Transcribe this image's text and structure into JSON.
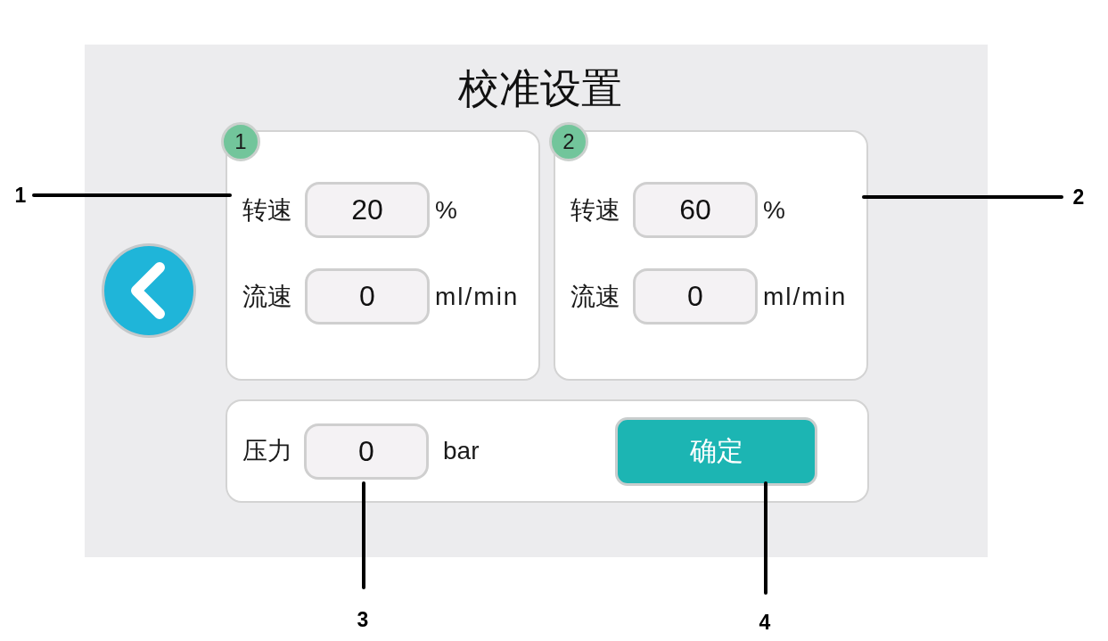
{
  "title": "校准设置",
  "cards": [
    {
      "badge": "1",
      "rows": [
        {
          "label": "转速",
          "value": "20",
          "unit": "%"
        },
        {
          "label": "流速",
          "value": "0",
          "unit": "ml/min"
        }
      ]
    },
    {
      "badge": "2",
      "rows": [
        {
          "label": "转速",
          "value": "60",
          "unit": "%"
        },
        {
          "label": "流速",
          "value": "0",
          "unit": "ml/min"
        }
      ]
    }
  ],
  "pressure": {
    "label": "压力",
    "value": "0",
    "unit": "bar"
  },
  "confirm_button": {
    "label": "确定"
  },
  "callouts": [
    {
      "label": "1"
    },
    {
      "label": "2"
    },
    {
      "label": "3"
    },
    {
      "label": "4"
    }
  ]
}
